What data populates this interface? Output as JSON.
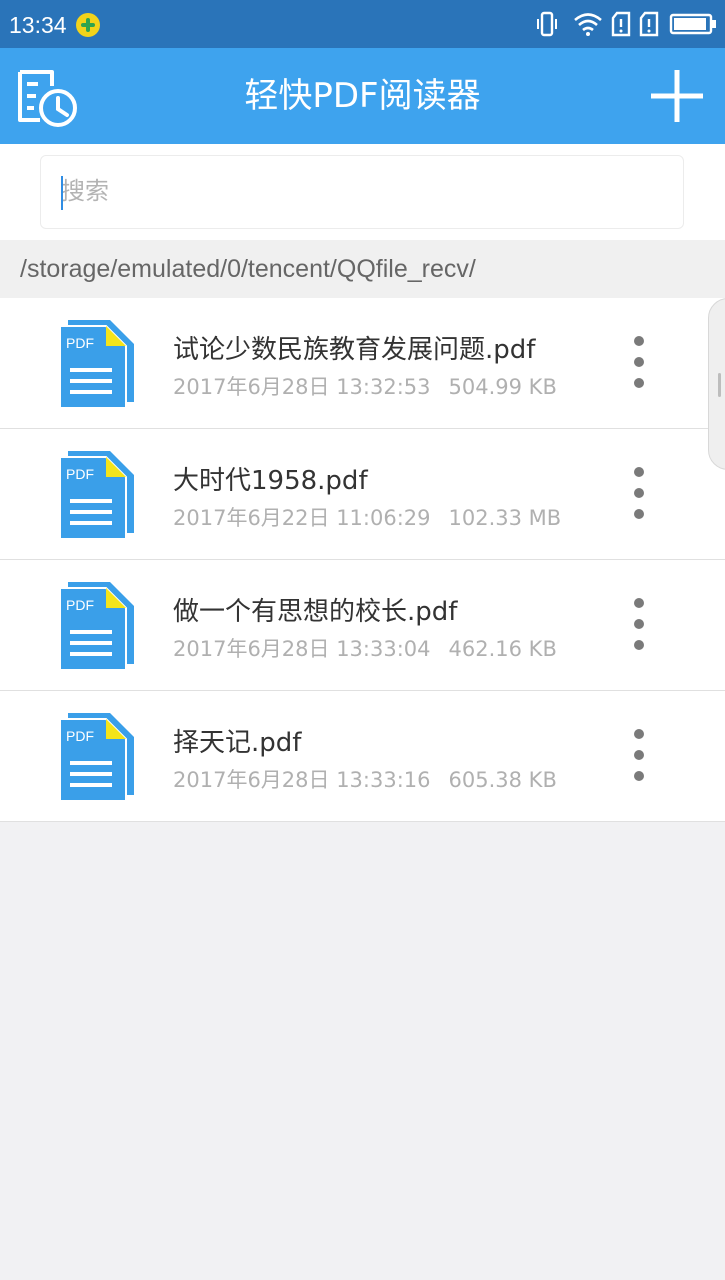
{
  "status_bar": {
    "time": "13:34",
    "icons": [
      "vibrate-icon",
      "wifi-icon",
      "sim1-icon",
      "sim2-icon",
      "battery-icon"
    ]
  },
  "app_bar": {
    "title": "轻快PDF阅读器",
    "left_icon": "history-file-icon",
    "right_icon": "plus-icon"
  },
  "search": {
    "placeholder": "搜索",
    "value": ""
  },
  "path": "/storage/emulated/0/tencent/QQfile_recv/",
  "files": [
    {
      "name": "试论少数民族教育发展问题.pdf",
      "date": "2017年6月28日 13:32:53",
      "size": "504.99 KB",
      "icon_label": "PDF"
    },
    {
      "name": "大时代1958.pdf",
      "date": "2017年6月22日 11:06:29",
      "size": "102.33 MB",
      "icon_label": "PDF"
    },
    {
      "name": "做一个有思想的校长.pdf",
      "date": "2017年6月28日 13:33:04",
      "size": "462.16 KB",
      "icon_label": "PDF"
    },
    {
      "name": "择天记.pdf",
      "date": "2017年6月28日 13:33:16",
      "size": "605.38 KB",
      "icon_label": "PDF"
    }
  ],
  "colors": {
    "status_bar": "#2a74b9",
    "app_bar": "#3ea3ee",
    "pdf_icon": "#3a9fe9",
    "pdf_icon_accent": "#f4e41a",
    "background": "#f1f1f3"
  }
}
